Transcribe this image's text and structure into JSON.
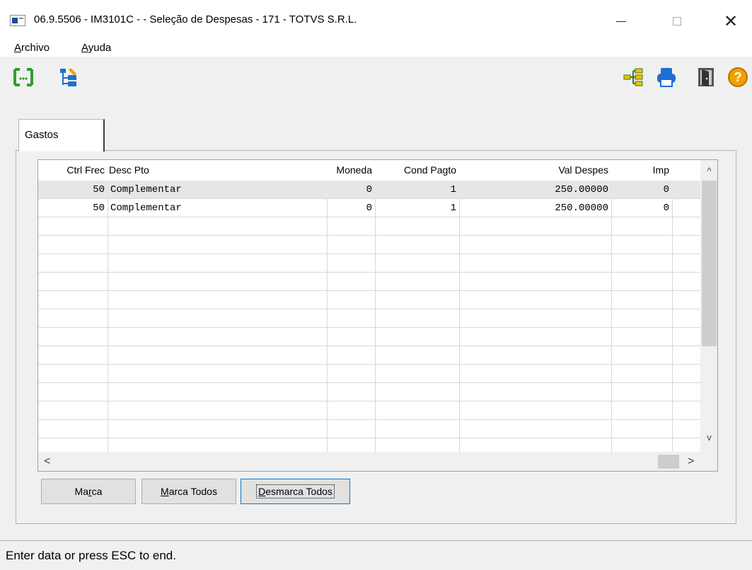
{
  "window": {
    "title": "06.9.5506 - IM3101C -  - Seleção de Despesas - 171 - TOTVS S.R.L.",
    "close_symbol": "✕"
  },
  "menu": {
    "archivo": "Archivo",
    "ayuda": "Ayuda"
  },
  "toolbar": {
    "left_icons": [
      "brackets-icon",
      "tree-edit-icon"
    ],
    "right_icons": [
      "hierarchy-icon",
      "printer-icon",
      "exit-door-icon",
      "help-icon"
    ]
  },
  "tab": {
    "label": "Gastos"
  },
  "grid": {
    "columns": [
      "Ctrl Frec",
      "Desc Pto",
      "Moneda",
      "Cond Pagto",
      "Val Despes",
      "Imp"
    ],
    "rows": [
      [
        "50",
        "Complementar",
        "0",
        "1",
        "250.00000",
        "0"
      ],
      [
        "50",
        "Complementar",
        "0",
        "1",
        "250.00000",
        "0"
      ]
    ],
    "empty_rows": 14,
    "selected_row": 0,
    "scroll_up": "^",
    "scroll_down": "v",
    "scroll_left": "<",
    "scroll_right": ">"
  },
  "buttons": {
    "marca": "Marca",
    "marca_todos": "Marca Todos",
    "desmarca_todos": "Desmarca Todos"
  },
  "status": {
    "text": "Enter data or press ESC to end."
  },
  "colors": {
    "accent": "#0078d7",
    "selected_row": "#e6e6e6",
    "icon_green": "#2e9e2e",
    "icon_blue": "#1e6fd0",
    "icon_orange": "#f0a000"
  }
}
